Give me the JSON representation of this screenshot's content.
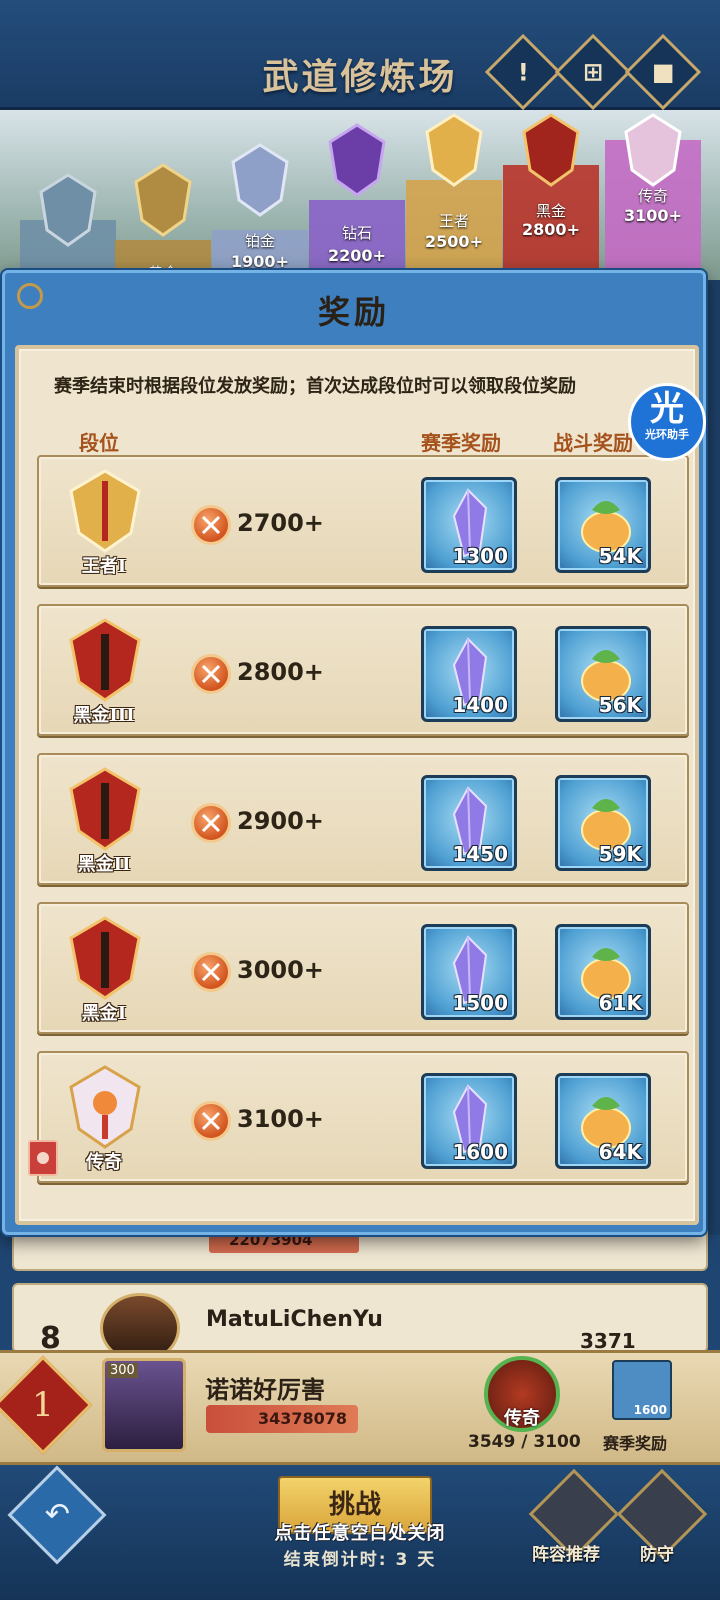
{
  "page": {
    "title": "武道修炼场",
    "top_buttons": [
      {
        "icon": "exclamation-icon",
        "glyph": "!"
      },
      {
        "icon": "gift-icon",
        "glyph": "⊞"
      },
      {
        "icon": "video-icon",
        "glyph": "■"
      }
    ]
  },
  "tier_strip": [
    {
      "name": "",
      "score": "",
      "color": "#6f8fa6"
    },
    {
      "name": "黄金",
      "score": "",
      "color": "#b08b42"
    },
    {
      "name": "铂金",
      "score": "1900+",
      "color": "#8fa0c8"
    },
    {
      "name": "钻石",
      "score": "2200+",
      "color": "#8a63c8"
    },
    {
      "name": "王者",
      "score": "2500+",
      "color": "#d4a34c"
    },
    {
      "name": "黑金",
      "score": "2800+",
      "color": "#b8342a"
    },
    {
      "name": "传奇",
      "score": "3100+",
      "color": "#c46cc4"
    }
  ],
  "modal": {
    "title": "奖励",
    "intro": "赛季结束时根据段位发放奖励；首次达成段位时可以领取段位奖励",
    "col_rank": "段位",
    "col_season": "赛季奖励",
    "col_battle": "战斗奖励",
    "rows": [
      {
        "rank": "王者I",
        "score": "2700+",
        "season_amount": "1300",
        "battle_amount": "54K",
        "emblem_color": "#e2b04a"
      },
      {
        "rank": "黑金III",
        "score": "2800+",
        "season_amount": "1400",
        "battle_amount": "56K",
        "emblem_color": "#b3271e"
      },
      {
        "rank": "黑金II",
        "score": "2900+",
        "season_amount": "1450",
        "battle_amount": "59K",
        "emblem_color": "#b3271e"
      },
      {
        "rank": "黑金I",
        "score": "3000+",
        "season_amount": "1500",
        "battle_amount": "61K",
        "emblem_color": "#b3271e"
      },
      {
        "rank": "传奇",
        "score": "3100+",
        "season_amount": "1600",
        "battle_amount": "64K",
        "emblem_color": "#d9a3c8"
      }
    ]
  },
  "watermark": {
    "big": "光",
    "small": "光环助手"
  },
  "leaderboard": {
    "row_partial_power": "22073904",
    "row8_rank": "8",
    "row8_name": "MatuLiChenYu",
    "row8_power": "3371"
  },
  "me": {
    "rank": "1",
    "level": "300",
    "name": "诺诺好厉害",
    "power": "34378078",
    "tier": "传奇",
    "progress": "3549 / 3100",
    "season_item_amount": "1600",
    "season_label": "赛季奖励"
  },
  "bottom": {
    "back_glyph": "↶",
    "challenge": "挑战",
    "close_hint": "点击任意空白处关闭",
    "countdown": "结束倒计时: 3 天",
    "lineup": "阵容推荐",
    "defense": "防守"
  }
}
